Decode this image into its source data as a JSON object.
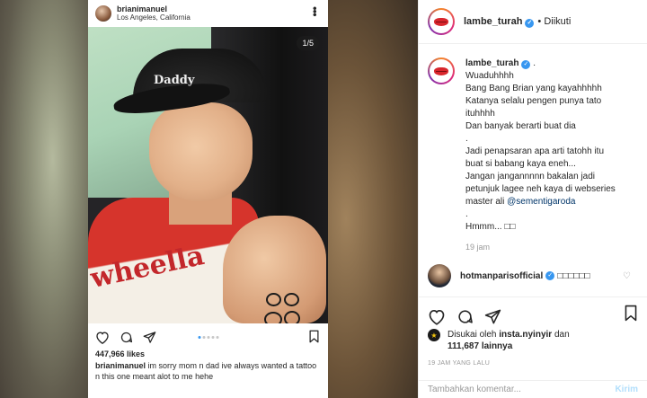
{
  "media": {
    "header": {
      "username": "brianimanuel",
      "location": "Los Angeles, California"
    },
    "counter": "1/5",
    "cap_text": "Daddy",
    "jersey_text": "wheella",
    "likes": "447,966 likes",
    "caption": {
      "username": "brianimanuel",
      "text": "im sorry mom n dad ive always wanted a tattoo n this one meant alot to me hehe"
    },
    "carousel": {
      "count": 5,
      "active": 1
    }
  },
  "panel": {
    "header": {
      "username": "lambe_turah",
      "follow_label": "• Diikuti"
    },
    "main_comment": {
      "username": "lambe_turah",
      "lines": [
        "Wuaduhhhh",
        "Bang Bang Brian yang kayahhhhh",
        "Katanya selalu pengen punya tato",
        "ituhhhh",
        "Dan banyak berarti buat dia",
        ".",
        "Jadi penapsaran apa arti tatohh itu",
        "buat si babang kaya eneh...",
        "Jangan jangannnnn bakalan jadi",
        "petunjuk lagee neh kaya di webseries",
        "master ali"
      ],
      "mention": "@sementigaroda",
      "tail_lines": [
        ".",
        "Hmmm... □□"
      ],
      "time": "19 jam"
    },
    "reply": {
      "username": "hotmanparisofficial",
      "text": "□□□□□□"
    },
    "liked_by": {
      "prefix": "Disukai oleh",
      "user": "insta.nyinyir",
      "joiner": "dan",
      "count": "111,687 lainnya"
    },
    "date": "19 JAM YANG LALU",
    "input": {
      "placeholder": "Tambahkan komentar...",
      "send_label": "Kirim"
    }
  },
  "colors": {
    "verified": "#3897f0",
    "mention": "#003569",
    "lips": "#d8262c"
  }
}
